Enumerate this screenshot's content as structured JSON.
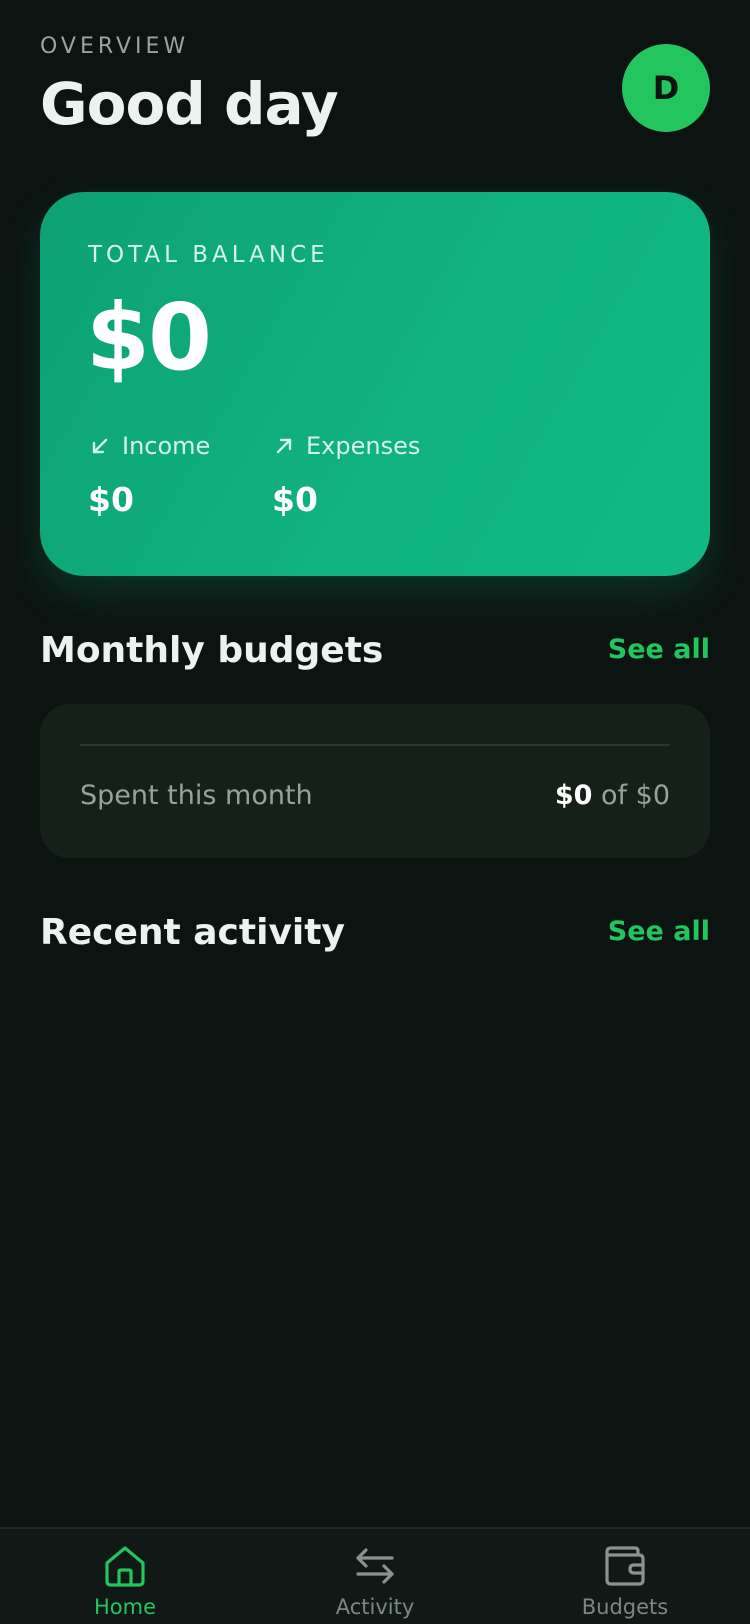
{
  "header": {
    "eyebrow": "OVERVIEW",
    "title": "Good day",
    "avatar_initial": "D"
  },
  "balance": {
    "label": "TOTAL BALANCE",
    "amount": "$0",
    "income_label": "Income",
    "income_value": "$0",
    "income_icon": "arrow-down-left-icon",
    "expenses_label": "Expenses",
    "expenses_value": "$0",
    "expenses_icon": "arrow-up-right-icon"
  },
  "budgets": {
    "title": "Monthly budgets",
    "see_all": "See all",
    "spent_label": "Spent this month",
    "spent_amount": "$0",
    "spent_of": "of $0"
  },
  "activity": {
    "title": "Recent activity",
    "see_all": "See all"
  },
  "nav": {
    "items": [
      {
        "label": "Home",
        "icon": "home-icon",
        "active": true
      },
      {
        "label": "Activity",
        "icon": "arrows-swap-icon",
        "active": false
      },
      {
        "label": "Budgets",
        "icon": "wallet-icon",
        "active": false
      }
    ]
  },
  "colors": {
    "background": "#0c1411",
    "accent": "#22c55e",
    "card_gradient_start": "#0ea174",
    "card_gradient_end": "#12b984",
    "surface": "#152019"
  }
}
